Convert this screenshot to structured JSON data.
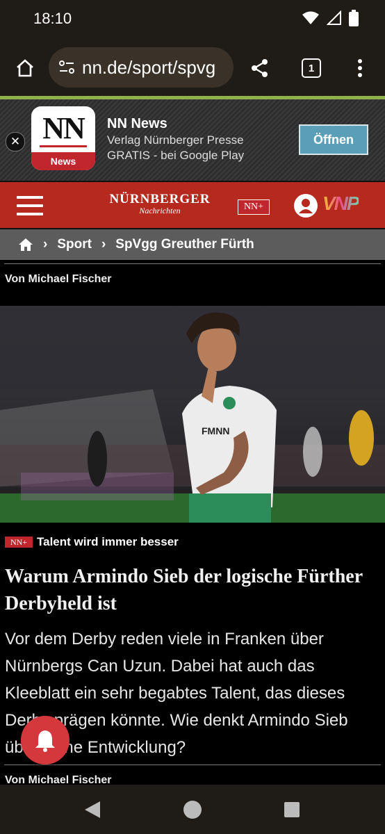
{
  "status": {
    "time": "18:10"
  },
  "browser": {
    "url": "nn.de/sport/spvg",
    "tab_count": "1"
  },
  "app_banner": {
    "icon_text": "NN",
    "icon_band": "News",
    "name": "NN News",
    "publisher": "Verlag Nürnberger Presse",
    "subtitle": "GRATIS - bei Google Play",
    "open_label": "Öffnen"
  },
  "site_header": {
    "logo_line1": "NÜRNBERGER",
    "logo_line2": "Nachrichten",
    "nnplus": "NN+",
    "vnp": "VNP"
  },
  "breadcrumb": {
    "items": [
      "Sport",
      "SpVgg Greuther Fürth"
    ]
  },
  "article": {
    "author_top": "Von Michael Fischer",
    "kicker_tag": "NN+",
    "kicker": "Talent wird immer besser",
    "headline": "Warum Armindo Sieb der logische Fürther Derbyheld ist",
    "teaser": "Vor dem Derby reden viele in Franken über Nürnbergs Can Uzun. Dabei hat auch das Kleeblatt ein sehr begabtes Talent, das dieses Derby prägen könnte. Wie denkt Armindo Sieb über seine Entwicklung?",
    "author_bottom": "Von Michael Fischer",
    "jersey_sponsor": "FMNN"
  },
  "colors": {
    "brand_red": "#b5291f",
    "accent_green": "#8fb04b",
    "button_blue": "#5a9eb7"
  },
  "icons": [
    "home-icon",
    "site-settings-icon",
    "share-icon",
    "menu-dots-icon",
    "close-icon",
    "user-icon",
    "microphone-icon",
    "bell-icon",
    "back-icon",
    "home-circle-icon",
    "recents-icon"
  ]
}
